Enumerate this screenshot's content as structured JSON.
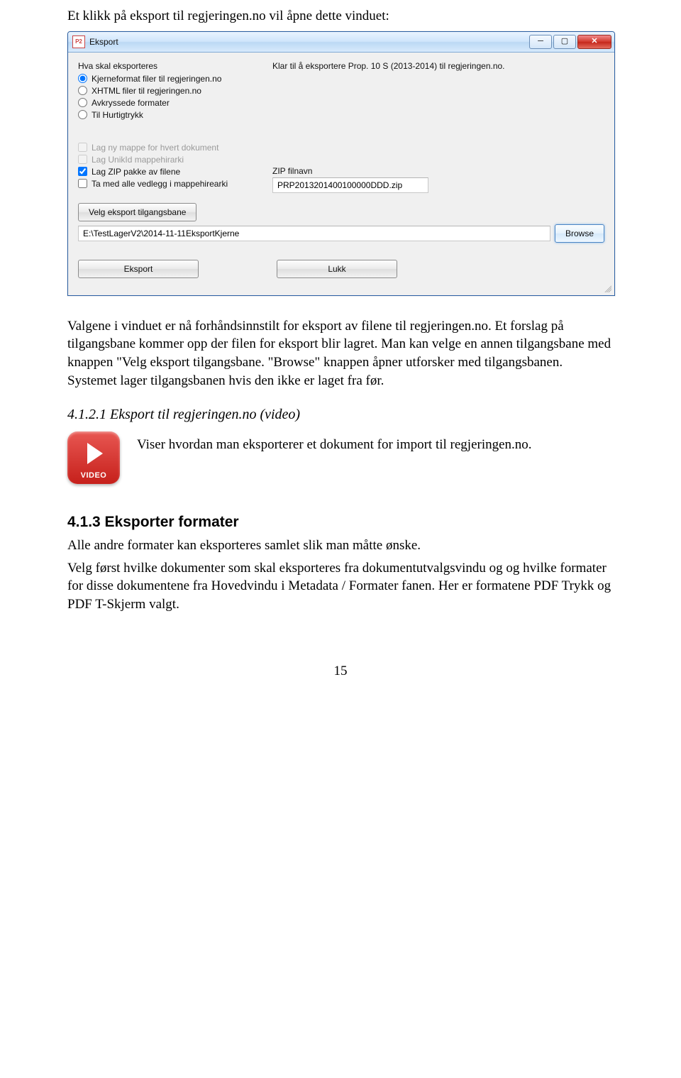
{
  "doc": {
    "intro": "Et klikk på eksport til regjeringen.no vil åpne dette vinduet:",
    "para1": "Valgene i vinduet er nå forhåndsinnstilt for eksport av filene til regjeringen.no. Et forslag på tilgangsbane kommer opp der filen for eksport blir lagret. Man kan velge en annen tilgangsbane med knappen \"Velg eksport tilgangsbane. \"Browse\" knappen åpner utforsker med tilgangsbanen. Systemet lager tilgangsbanen hvis den ikke er laget fra før.",
    "video_heading": "4.1.2.1 Eksport til regjeringen.no (video)",
    "video_caption": "Viser hvordan man eksporterer et dokument for import til regjeringen.no.",
    "sec413_title": "4.1.3   Eksporter formater",
    "sec413_p1": "Alle andre formater kan eksporteres samlet slik man måtte ønske.",
    "sec413_p2": "Velg først hvilke dokumenter som skal eksporteres fra dokumentutvalgsvindu og  og hvilke formater for disse dokumentene fra Hovedvindu i Metadata / Formater fanen. Her er formatene PDF Trykk og PDF T-Skjerm valgt.",
    "page_number": "15"
  },
  "win": {
    "title": "Eksport",
    "icon_text": "P2",
    "status_line": "Klar til å eksportere Prop. 10 S (2013-2014) til regjeringen.no.",
    "section_label": "Hva skal eksporteres",
    "radios": [
      "Kjerneformat filer til regjeringen.no",
      "XHTML filer til regjeringen.no",
      "Avkryssede formater",
      "Til Hurtigtrykk"
    ],
    "radio_selected_index": 0,
    "checks": [
      {
        "label": "Lag ny mappe for hvert dokument",
        "checked": false,
        "disabled": true
      },
      {
        "label": "Lag UnikId mappehirarki",
        "checked": false,
        "disabled": true
      },
      {
        "label": "Lag ZIP pakke av filene",
        "checked": true,
        "disabled": false
      },
      {
        "label": "Ta med alle vedlegg i mappehirearki",
        "checked": false,
        "disabled": false
      }
    ],
    "zip_label": "ZIP filnavn",
    "zip_value": "PRP2013201400100000DDD.zip",
    "choose_path_btn": "Velg eksport tilgangsbane",
    "path_value": "E:\\TestLagerV2\\2014-11-11EksportKjerne",
    "browse_btn": "Browse",
    "export_btn": "Eksport",
    "close_btn": "Lukk",
    "video_label": "VIDEO"
  }
}
